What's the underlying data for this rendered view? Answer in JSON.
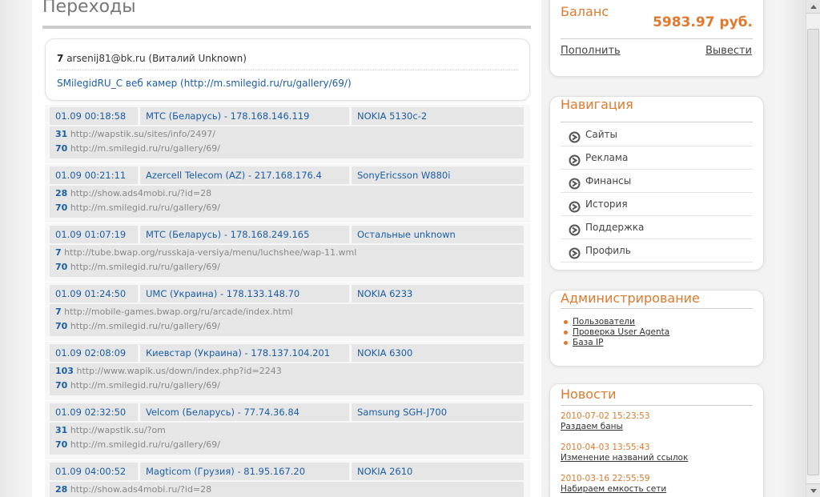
{
  "page_title": "Переходы",
  "summary": {
    "count": "7",
    "user": "arsenij81@bk.ru (Виталий Unknown)",
    "link": "SMilegidRU_C веб камер (http://m.smilegid.ru/ru/gallery/69/)"
  },
  "entries": [
    {
      "time": "01.09 00:18:58",
      "operator": "МТС (Беларусь) - 178.168.146.119",
      "device": "NOKIA 5130c-2",
      "ref": {
        "id": "31",
        "url": "http://wapstik.su/sites/info/2497/"
      },
      "target": {
        "id": "70",
        "url": "http://m.smilegid.ru/ru/gallery/69/"
      }
    },
    {
      "time": "01.09 00:21:11",
      "operator": "Azercell Telecom (AZ) - 217.168.176.4",
      "device": "SonyEricsson W880i",
      "ref": {
        "id": "28",
        "url": "http://show.ads4mobi.ru/?id=28"
      },
      "target": {
        "id": "70",
        "url": "http://m.smilegid.ru/ru/gallery/69/"
      }
    },
    {
      "time": "01.09 01:07:19",
      "operator": "МТС (Беларусь) - 178.168.249.165",
      "device": "Остальные unknown",
      "ref": {
        "id": "7",
        "url": "http://tube.bwap.org/russkaja-versiya/menu/luchshee/wap-11.wml"
      },
      "target": {
        "id": "70",
        "url": "http://m.smilegid.ru/ru/gallery/69/"
      }
    },
    {
      "time": "01.09 01:24:50",
      "operator": "UMC (Украина) - 178.133.148.70",
      "device": "NOKIA 6233",
      "ref": {
        "id": "7",
        "url": "http://mobile-games.bwap.org/ru/arcade/index.html"
      },
      "target": {
        "id": "70",
        "url": "http://m.smilegid.ru/ru/gallery/69/"
      }
    },
    {
      "time": "01.09 02:08:09",
      "operator": "Киевстар (Украина) - 178.137.104.201",
      "device": "NOKIA 6300",
      "ref": {
        "id": "103",
        "url": "http://www.wapik.us/down/index.php?id=2243"
      },
      "target": {
        "id": "70",
        "url": "http://m.smilegid.ru/ru/gallery/69/"
      }
    },
    {
      "time": "01.09 02:32:50",
      "operator": "Velcom (Беларусь) - 77.74.36.84",
      "device": "Samsung SGH-J700",
      "ref": {
        "id": "31",
        "url": "http://wapstik.su/?om"
      },
      "target": {
        "id": "70",
        "url": "http://m.smilegid.ru/ru/gallery/69/"
      }
    },
    {
      "time": "01.09 04:00:52",
      "operator": "Magticom (Грузия) - 81.95.167.20",
      "device": "NOKIA 2610",
      "ref": {
        "id": "28",
        "url": "http://show.ads4mobi.ru/?id=28"
      },
      "target": {
        "id": "",
        "url": ""
      }
    }
  ],
  "balance": {
    "title": "Баланс",
    "amount": "5983.97 руб.",
    "deposit": "Пополнить",
    "withdraw": "Вывести"
  },
  "navigation": {
    "title": "Навигация",
    "items": [
      "Сайты",
      "Реклама",
      "Финансы",
      "История",
      "Поддержка",
      "Профиль"
    ],
    "icon": "arrow-circle-icon"
  },
  "admin": {
    "title": "Администрирование",
    "items": [
      "Пользователи",
      "Проверка User Agenta",
      "База IP"
    ]
  },
  "news": {
    "title": "Новости",
    "items": [
      {
        "date": "2010-07-02 15:23:53",
        "title": "Раздаем баны"
      },
      {
        "date": "2010-04-03 13:55:43",
        "title": "Изменение названий ссылок"
      },
      {
        "date": "2010-03-16 22:55:59",
        "title": "Набираем емкость сети"
      }
    ]
  },
  "colors": {
    "accent": "#e0792d",
    "link": "#1a5ea8",
    "cell_bg": "#e6e6e6"
  }
}
